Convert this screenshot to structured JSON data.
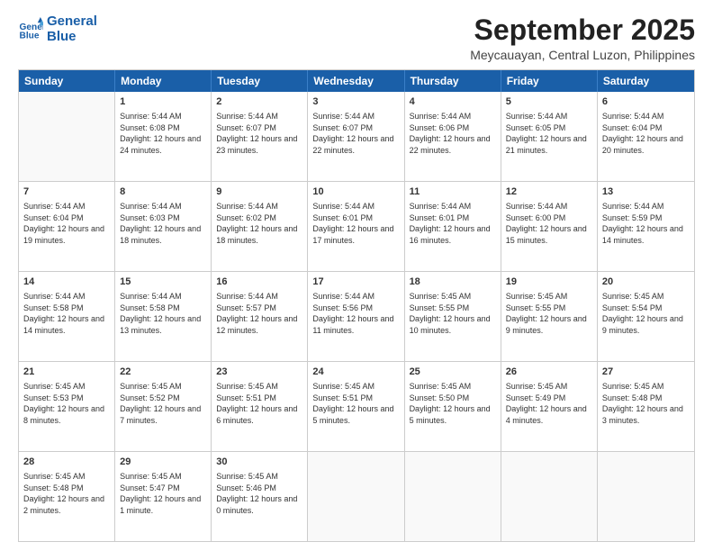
{
  "logo": {
    "line1": "General",
    "line2": "Blue"
  },
  "title": "September 2025",
  "location": "Meycauayan, Central Luzon, Philippines",
  "header_days": [
    "Sunday",
    "Monday",
    "Tuesday",
    "Wednesday",
    "Thursday",
    "Friday",
    "Saturday"
  ],
  "weeks": [
    [
      {
        "day": "",
        "empty": true
      },
      {
        "day": "1",
        "sunrise": "5:44 AM",
        "sunset": "6:08 PM",
        "daylight": "12 hours and 24 minutes."
      },
      {
        "day": "2",
        "sunrise": "5:44 AM",
        "sunset": "6:07 PM",
        "daylight": "12 hours and 23 minutes."
      },
      {
        "day": "3",
        "sunrise": "5:44 AM",
        "sunset": "6:07 PM",
        "daylight": "12 hours and 22 minutes."
      },
      {
        "day": "4",
        "sunrise": "5:44 AM",
        "sunset": "6:06 PM",
        "daylight": "12 hours and 22 minutes."
      },
      {
        "day": "5",
        "sunrise": "5:44 AM",
        "sunset": "6:05 PM",
        "daylight": "12 hours and 21 minutes."
      },
      {
        "day": "6",
        "sunrise": "5:44 AM",
        "sunset": "6:04 PM",
        "daylight": "12 hours and 20 minutes."
      }
    ],
    [
      {
        "day": "7",
        "sunrise": "5:44 AM",
        "sunset": "6:04 PM",
        "daylight": "12 hours and 19 minutes."
      },
      {
        "day": "8",
        "sunrise": "5:44 AM",
        "sunset": "6:03 PM",
        "daylight": "12 hours and 18 minutes."
      },
      {
        "day": "9",
        "sunrise": "5:44 AM",
        "sunset": "6:02 PM",
        "daylight": "12 hours and 18 minutes."
      },
      {
        "day": "10",
        "sunrise": "5:44 AM",
        "sunset": "6:01 PM",
        "daylight": "12 hours and 17 minutes."
      },
      {
        "day": "11",
        "sunrise": "5:44 AM",
        "sunset": "6:01 PM",
        "daylight": "12 hours and 16 minutes."
      },
      {
        "day": "12",
        "sunrise": "5:44 AM",
        "sunset": "6:00 PM",
        "daylight": "12 hours and 15 minutes."
      },
      {
        "day": "13",
        "sunrise": "5:44 AM",
        "sunset": "5:59 PM",
        "daylight": "12 hours and 14 minutes."
      }
    ],
    [
      {
        "day": "14",
        "sunrise": "5:44 AM",
        "sunset": "5:58 PM",
        "daylight": "12 hours and 14 minutes."
      },
      {
        "day": "15",
        "sunrise": "5:44 AM",
        "sunset": "5:58 PM",
        "daylight": "12 hours and 13 minutes."
      },
      {
        "day": "16",
        "sunrise": "5:44 AM",
        "sunset": "5:57 PM",
        "daylight": "12 hours and 12 minutes."
      },
      {
        "day": "17",
        "sunrise": "5:44 AM",
        "sunset": "5:56 PM",
        "daylight": "12 hours and 11 minutes."
      },
      {
        "day": "18",
        "sunrise": "5:45 AM",
        "sunset": "5:55 PM",
        "daylight": "12 hours and 10 minutes."
      },
      {
        "day": "19",
        "sunrise": "5:45 AM",
        "sunset": "5:55 PM",
        "daylight": "12 hours and 9 minutes."
      },
      {
        "day": "20",
        "sunrise": "5:45 AM",
        "sunset": "5:54 PM",
        "daylight": "12 hours and 9 minutes."
      }
    ],
    [
      {
        "day": "21",
        "sunrise": "5:45 AM",
        "sunset": "5:53 PM",
        "daylight": "12 hours and 8 minutes."
      },
      {
        "day": "22",
        "sunrise": "5:45 AM",
        "sunset": "5:52 PM",
        "daylight": "12 hours and 7 minutes."
      },
      {
        "day": "23",
        "sunrise": "5:45 AM",
        "sunset": "5:51 PM",
        "daylight": "12 hours and 6 minutes."
      },
      {
        "day": "24",
        "sunrise": "5:45 AM",
        "sunset": "5:51 PM",
        "daylight": "12 hours and 5 minutes."
      },
      {
        "day": "25",
        "sunrise": "5:45 AM",
        "sunset": "5:50 PM",
        "daylight": "12 hours and 5 minutes."
      },
      {
        "day": "26",
        "sunrise": "5:45 AM",
        "sunset": "5:49 PM",
        "daylight": "12 hours and 4 minutes."
      },
      {
        "day": "27",
        "sunrise": "5:45 AM",
        "sunset": "5:48 PM",
        "daylight": "12 hours and 3 minutes."
      }
    ],
    [
      {
        "day": "28",
        "sunrise": "5:45 AM",
        "sunset": "5:48 PM",
        "daylight": "12 hours and 2 minutes."
      },
      {
        "day": "29",
        "sunrise": "5:45 AM",
        "sunset": "5:47 PM",
        "daylight": "12 hours and 1 minute."
      },
      {
        "day": "30",
        "sunrise": "5:45 AM",
        "sunset": "5:46 PM",
        "daylight": "12 hours and 0 minutes."
      },
      {
        "day": "",
        "empty": true
      },
      {
        "day": "",
        "empty": true
      },
      {
        "day": "",
        "empty": true
      },
      {
        "day": "",
        "empty": true
      }
    ]
  ]
}
